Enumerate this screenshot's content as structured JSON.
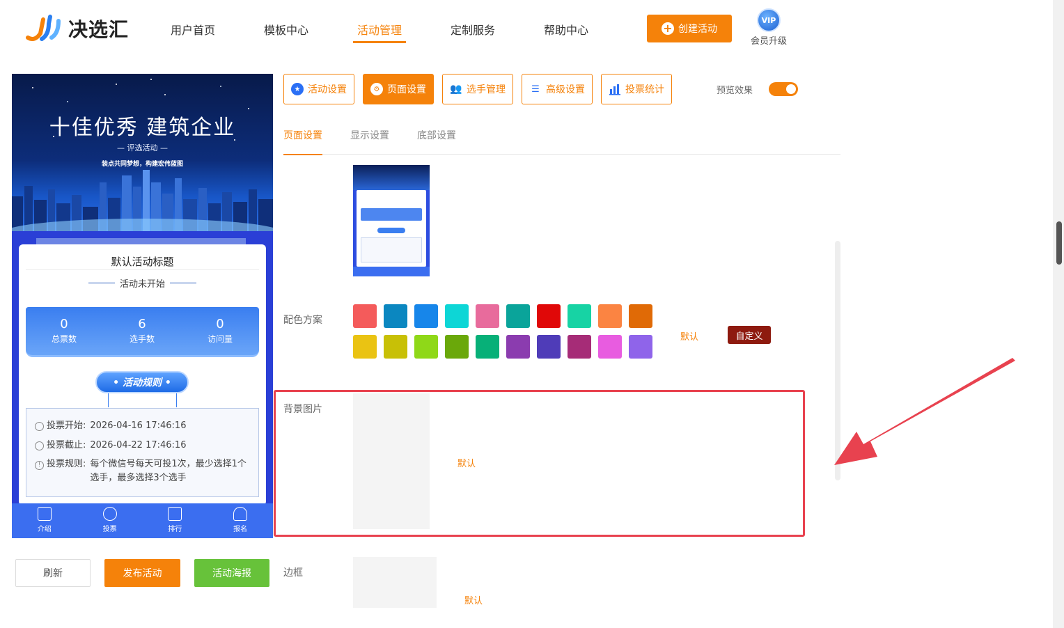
{
  "header": {
    "logo_text": "决选汇",
    "nav": [
      {
        "label": "用户首页",
        "active": false
      },
      {
        "label": "模板中心",
        "active": false
      },
      {
        "label": "活动管理",
        "active": true
      },
      {
        "label": "定制服务",
        "active": false
      },
      {
        "label": "帮助中心",
        "active": false
      }
    ],
    "create_label": "创建活动",
    "vip_badge": "VIP",
    "vip_label": "会员升级"
  },
  "preview": {
    "banner_title": "十佳优秀 建筑企业",
    "banner_sub": "— 评选活动 —",
    "banner_slogan": "装点共同梦想，构建宏伟蓝图",
    "card_title": "默认活动标题",
    "status": "活动未开始",
    "stats": [
      {
        "value": "0",
        "label": "总票数"
      },
      {
        "value": "6",
        "label": "选手数"
      },
      {
        "value": "0",
        "label": "访问量"
      }
    ],
    "rules_btn": "• 活动规则 •",
    "rules": [
      {
        "label": "投票开始:",
        "value": "2026-04-16 17:46:16"
      },
      {
        "label": "投票截止:",
        "value": "2026-04-22 17:46:16"
      },
      {
        "label": "投票规则:",
        "value": "每个微信号每天可投1次，最少选择1个选手，最多选择3个选手"
      }
    ],
    "tabs": [
      "介绍",
      "投票",
      "排行",
      "报名"
    ]
  },
  "actions": {
    "refresh": "刷新",
    "publish": "发布活动",
    "poster": "活动海报"
  },
  "toolbar": [
    {
      "label": "活动设置",
      "icon": "star-icon",
      "active": false
    },
    {
      "label": "页面设置",
      "icon": "gear-icon",
      "active": true
    },
    {
      "label": "选手管理",
      "icon": "users-icon",
      "active": false
    },
    {
      "label": "高级设置",
      "icon": "sliders-icon",
      "active": false
    },
    {
      "label": "投票统计",
      "icon": "bar-chart-icon",
      "active": false
    }
  ],
  "preview_toggle_label": "预览效果",
  "subtabs": [
    {
      "label": "页面设置",
      "active": true
    },
    {
      "label": "显示设置",
      "active": false
    },
    {
      "label": "底部设置",
      "active": false
    }
  ],
  "color_scheme": {
    "label": "配色方案",
    "colors": [
      "#f45b5b",
      "#0b87c0",
      "#1786ea",
      "#0dd6d6",
      "#e86b9c",
      "#0aa49a",
      "#e00808",
      "#17d3a4",
      "#fb8442",
      "#e06a06",
      "#eac313",
      "#c8c006",
      "#8fd818",
      "#6aa80a",
      "#07b078",
      "#8b3caf",
      "#4f3cb8",
      "#a62c77",
      "#e85ce0",
      "#8f64ea"
    ],
    "default_label": "默认",
    "custom_label": "自定义"
  },
  "background": {
    "label": "背景图片",
    "default_label": "默认"
  },
  "border": {
    "label": "边框",
    "default_label": "默认"
  }
}
